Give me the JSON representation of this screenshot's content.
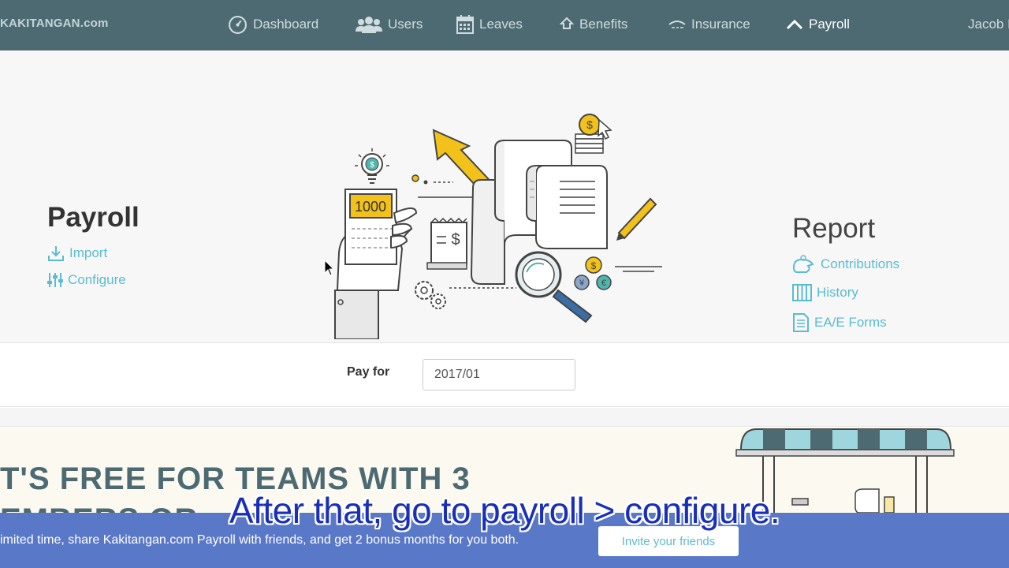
{
  "brand": "KAKITANGAN.com",
  "nav": {
    "items": [
      {
        "label": "Dashboard",
        "icon": "dashboard-gauge-icon"
      },
      {
        "label": "Users",
        "icon": "users-icon"
      },
      {
        "label": "Leaves",
        "icon": "calendar-icon"
      },
      {
        "label": "Benefits",
        "icon": "benefits-icon"
      },
      {
        "label": "Insurance",
        "icon": "umbrella-icon"
      },
      {
        "label": "Payroll",
        "icon": "payroll-icon",
        "active": true
      }
    ],
    "user": "Jacob L"
  },
  "payroll": {
    "title": "Payroll",
    "links": [
      {
        "label": "Import",
        "icon": "download-icon"
      },
      {
        "label": "Configure",
        "icon": "sliders-icon"
      }
    ]
  },
  "illustration": {
    "calculator_display": "1000"
  },
  "report": {
    "title": "Report",
    "links": [
      {
        "label": "Contributions",
        "icon": "hand-coins-icon"
      },
      {
        "label": "History",
        "icon": "history-columns-icon"
      },
      {
        "label": "EA/E Forms",
        "icon": "form-document-icon"
      }
    ]
  },
  "pay_for": {
    "label": "Pay for",
    "value": "2017/01"
  },
  "promo": {
    "headline_line1": "T'S FREE FOR TEAMS WITH 3",
    "headline_line2": "EMBERS OR",
    "share_text": "imited time, share Kakitangan.com Payroll with friends, and get 2 bonus months for you both.",
    "invite_label": "Invite your friends"
  },
  "subtitle": "After that, go to payroll > configure.",
  "colors": {
    "navbar": "#4d6a72",
    "link": "#5bbcd1",
    "share_bar": "#5a78c8",
    "accent_yellow": "#f2c21a"
  }
}
